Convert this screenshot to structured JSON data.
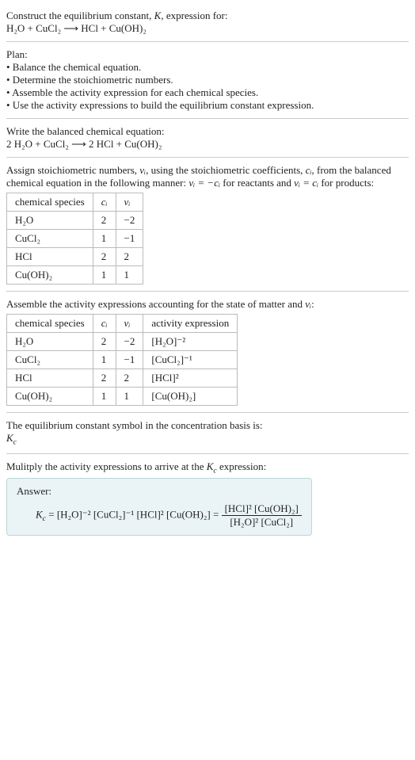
{
  "intro": {
    "line1_prefix": "Construct the equilibrium constant, ",
    "K": "K",
    "line1_suffix": ", expression for:",
    "equation": "H₂O + CuCl₂ ⟶ HCl + Cu(OH)₂"
  },
  "plan": {
    "heading": "Plan:",
    "b1": "• Balance the chemical equation.",
    "b2": "• Determine the stoichiometric numbers.",
    "b3": "• Assemble the activity expression for each chemical species.",
    "b4": "• Use the activity expressions to build the equilibrium constant expression."
  },
  "balanced": {
    "heading": "Write the balanced chemical equation:",
    "equation": "2 H₂O + CuCl₂ ⟶ 2 HCl + Cu(OH)₂"
  },
  "stoich": {
    "text_a": "Assign stoichiometric numbers, ",
    "nu_i": "νᵢ",
    "text_b": ", using the stoichiometric coefficients, ",
    "c_i": "cᵢ",
    "text_c": ", from the balanced chemical equation in the following manner: ",
    "rel1": "νᵢ = −cᵢ",
    "text_d": " for reactants and ",
    "rel2": "νᵢ = cᵢ",
    "text_e": " for products:",
    "headers": {
      "h1": "chemical species",
      "h2": "cᵢ",
      "h3": "νᵢ"
    },
    "rows": [
      {
        "sp": "H₂O",
        "c": "2",
        "nu": "−2"
      },
      {
        "sp": "CuCl₂",
        "c": "1",
        "nu": "−1"
      },
      {
        "sp": "HCl",
        "c": "2",
        "nu": "2"
      },
      {
        "sp": "Cu(OH)₂",
        "c": "1",
        "nu": "1"
      }
    ]
  },
  "activity": {
    "text_a": "Assemble the activity expressions accounting for the state of matter and ",
    "nu_i": "νᵢ",
    "text_b": ":",
    "headers": {
      "h1": "chemical species",
      "h2": "cᵢ",
      "h3": "νᵢ",
      "h4": "activity expression"
    },
    "rows": [
      {
        "sp": "H₂O",
        "c": "2",
        "nu": "−2",
        "act": "[H₂O]⁻²"
      },
      {
        "sp": "CuCl₂",
        "c": "1",
        "nu": "−1",
        "act": "[CuCl₂]⁻¹"
      },
      {
        "sp": "HCl",
        "c": "2",
        "nu": "2",
        "act": "[HCl]²"
      },
      {
        "sp": "Cu(OH)₂",
        "c": "1",
        "nu": "1",
        "act": "[Cu(OH)₂]"
      }
    ]
  },
  "kc_symbol": {
    "text": "The equilibrium constant symbol in the concentration basis is:",
    "symbol_K": "K",
    "symbol_c": "c"
  },
  "multiply": {
    "text_a": "Mulitply the activity expressions to arrive at the ",
    "Kc_K": "K",
    "Kc_c": "c",
    "text_b": " expression:"
  },
  "answer": {
    "label": "Answer:",
    "lhs_K": "K",
    "lhs_c": "c",
    "eq": " = ",
    "prod": "[H₂O]⁻² [CuCl₂]⁻¹ [HCl]² [Cu(OH)₂] = ",
    "num": "[HCl]² [Cu(OH)₂]",
    "den": "[H₂O]² [CuCl₂]"
  }
}
